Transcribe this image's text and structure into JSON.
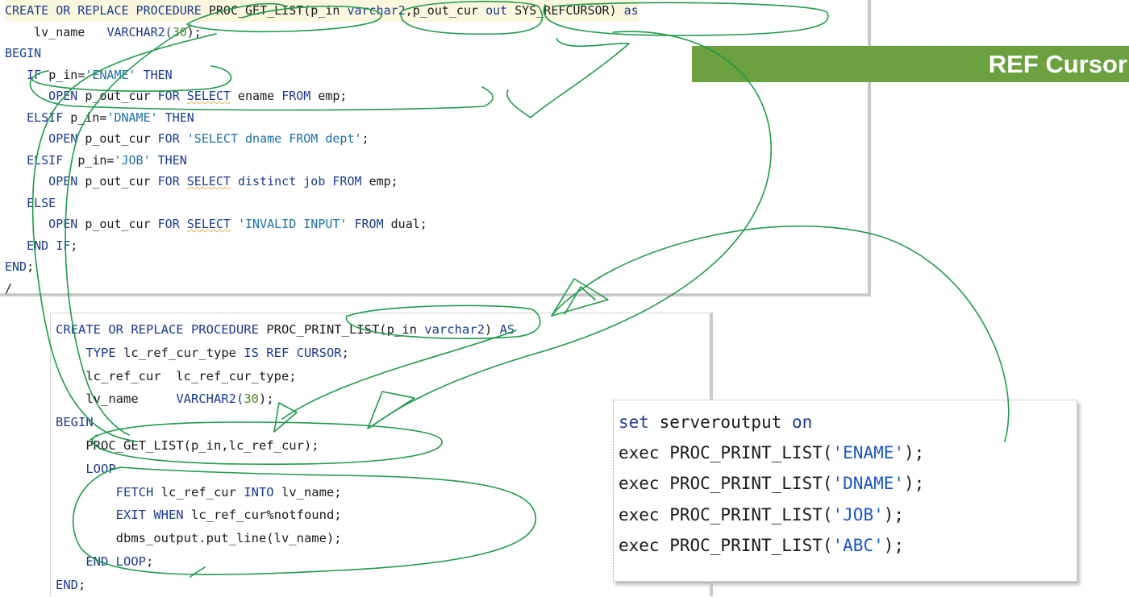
{
  "banner": {
    "title": "REF Cursor"
  },
  "panel1": {
    "lines": [
      [
        {
          "t": "CREATE OR REPLACE PROCEDURE ",
          "c": "kw"
        },
        {
          "t": "PROC_GET_LIST(p_in ",
          "c": "plain"
        },
        {
          "t": "varchar2",
          "c": "kw"
        },
        {
          "t": ",p_out_cur ",
          "c": "plain"
        },
        {
          "t": "out ",
          "c": "kw"
        },
        {
          "t": "SYS_REFCURSOR) ",
          "c": "plain"
        },
        {
          "t": "as",
          "c": "kw"
        }
      ],
      [
        {
          "t": "    lv_name   ",
          "c": "plain"
        },
        {
          "t": "VARCHAR2(",
          "c": "kw"
        },
        {
          "t": "30",
          "c": "num"
        },
        {
          "t": ");",
          "c": "plain"
        }
      ],
      [
        {
          "t": "BEGIN",
          "c": "kw"
        }
      ],
      [
        {
          "t": "   IF ",
          "c": "kw"
        },
        {
          "t": "p_in=",
          "c": "plain"
        },
        {
          "t": "'ENAME'",
          "c": "str"
        },
        {
          "t": " THEN",
          "c": "kw"
        }
      ],
      [
        {
          "t": "      OPEN ",
          "c": "kw"
        },
        {
          "t": "p_out_cur ",
          "c": "plain"
        },
        {
          "t": "FOR ",
          "c": "kw"
        },
        {
          "t": "SELECT",
          "c": "kw squig"
        },
        {
          "t": " ename ",
          "c": "plain"
        },
        {
          "t": "FROM ",
          "c": "kw"
        },
        {
          "t": "emp;",
          "c": "plain"
        }
      ],
      [
        {
          "t": "   ELSIF ",
          "c": "kw"
        },
        {
          "t": "p_in=",
          "c": "plain"
        },
        {
          "t": "'DNAME'",
          "c": "str"
        },
        {
          "t": " THEN",
          "c": "kw"
        }
      ],
      [
        {
          "t": "      OPEN ",
          "c": "kw"
        },
        {
          "t": "p_out_cur ",
          "c": "plain"
        },
        {
          "t": "FOR ",
          "c": "kw"
        },
        {
          "t": "'SELECT dname FROM dept'",
          "c": "str"
        },
        {
          "t": ";",
          "c": "plain"
        }
      ],
      [
        {
          "t": "   ELSIF  ",
          "c": "kw"
        },
        {
          "t": "p_in=",
          "c": "plain"
        },
        {
          "t": "'JOB'",
          "c": "str"
        },
        {
          "t": " THEN",
          "c": "kw"
        }
      ],
      [
        {
          "t": "      OPEN ",
          "c": "kw"
        },
        {
          "t": "p_out_cur ",
          "c": "plain"
        },
        {
          "t": "FOR ",
          "c": "kw"
        },
        {
          "t": "SELECT",
          "c": "kw squig"
        },
        {
          "t": " distinct job ",
          "c": "kw"
        },
        {
          "t": "FROM ",
          "c": "kw"
        },
        {
          "t": "emp;",
          "c": "plain"
        }
      ],
      [
        {
          "t": "   ELSE",
          "c": "kw"
        }
      ],
      [
        {
          "t": "      OPEN ",
          "c": "kw"
        },
        {
          "t": "p_out_cur ",
          "c": "plain"
        },
        {
          "t": "FOR ",
          "c": "kw"
        },
        {
          "t": "SELECT",
          "c": "kw squig"
        },
        {
          "t": " 'INVALID INPUT' ",
          "c": "str"
        },
        {
          "t": "FROM ",
          "c": "kw"
        },
        {
          "t": "dual;",
          "c": "plain"
        }
      ],
      [
        {
          "t": "   END IF",
          "c": "kw"
        },
        {
          "t": ";",
          "c": "plain"
        }
      ],
      [
        {
          "t": "END",
          "c": "kw"
        },
        {
          "t": ";",
          "c": "plain"
        }
      ],
      [
        {
          "t": "/",
          "c": "plain"
        }
      ]
    ]
  },
  "panel2": {
    "lines": [
      [
        {
          "t": "CREATE OR REPLACE PROCEDURE ",
          "c": "kw"
        },
        {
          "t": "PROC_PRINT_LIST(p_in ",
          "c": "plain"
        },
        {
          "t": "varchar2",
          "c": "kw"
        },
        {
          "t": ") ",
          "c": "plain"
        },
        {
          "t": "AS",
          "c": "kw"
        }
      ],
      [
        {
          "t": "    TYPE ",
          "c": "kw"
        },
        {
          "t": "lc_ref_cur_type ",
          "c": "plain"
        },
        {
          "t": "IS REF CURSOR",
          "c": "kw"
        },
        {
          "t": ";",
          "c": "plain"
        }
      ],
      [
        {
          "t": "    lc_ref_cur  lc_ref_cur_type;",
          "c": "plain"
        }
      ],
      [
        {
          "t": "    lv_name     ",
          "c": "plain"
        },
        {
          "t": "VARCHAR2(",
          "c": "kw"
        },
        {
          "t": "30",
          "c": "num"
        },
        {
          "t": ");",
          "c": "plain"
        }
      ],
      [
        {
          "t": "BEGIN",
          "c": "kw"
        }
      ],
      [
        {
          "t": "    PROC_GET_LIST(p_in,lc_ref_cur);",
          "c": "plain"
        }
      ],
      [
        {
          "t": "    LOOP",
          "c": "kw"
        }
      ],
      [
        {
          "t": "        FETCH ",
          "c": "kw"
        },
        {
          "t": "lc_ref_cur ",
          "c": "plain"
        },
        {
          "t": "INTO ",
          "c": "kw"
        },
        {
          "t": "lv_name;",
          "c": "plain"
        }
      ],
      [
        {
          "t": "        EXIT WHEN ",
          "c": "kw"
        },
        {
          "t": "lc_ref_cur%notfound;",
          "c": "plain"
        }
      ],
      [
        {
          "t": "        dbms_output.put_line(lv_name);",
          "c": "plain"
        }
      ],
      [
        {
          "t": "    END LOOP",
          "c": "kw"
        },
        {
          "t": ";",
          "c": "plain"
        }
      ],
      [
        {
          "t": "END",
          "c": "kw"
        },
        {
          "t": ";",
          "c": "plain"
        }
      ]
    ]
  },
  "panel3": {
    "lines": [
      [
        {
          "t": "set ",
          "c": "kw"
        },
        {
          "t": "serveroutput ",
          "c": "plain"
        },
        {
          "t": "on",
          "c": "kw"
        }
      ],
      [
        {
          "t": "exec ",
          "c": "plain"
        },
        {
          "t": "PROC_PRINT_LIST(",
          "c": "plain"
        },
        {
          "t": "'ENAME'",
          "c": "str3"
        },
        {
          "t": ");",
          "c": "plain"
        }
      ],
      [
        {
          "t": "exec ",
          "c": "plain"
        },
        {
          "t": "PROC_PRINT_LIST(",
          "c": "plain"
        },
        {
          "t": "'DNAME'",
          "c": "str3"
        },
        {
          "t": ");",
          "c": "plain"
        }
      ],
      [
        {
          "t": "exec ",
          "c": "plain"
        },
        {
          "t": "PROC_PRINT_LIST(",
          "c": "plain"
        },
        {
          "t": "'JOB'",
          "c": "str3"
        },
        {
          "t": ");",
          "c": "plain"
        }
      ],
      [
        {
          "t": "exec ",
          "c": "plain"
        },
        {
          "t": "PROC_PRINT_LIST(",
          "c": "plain"
        },
        {
          "t": "'ABC'",
          "c": "str3"
        },
        {
          "t": ");",
          "c": "plain"
        }
      ]
    ]
  },
  "colors": {
    "keyword": "#1a3c8f",
    "string": "#1d6fa5",
    "number": "#4b8a1f",
    "banner": "#6ba13f",
    "annotation": "#1f9a4a"
  }
}
